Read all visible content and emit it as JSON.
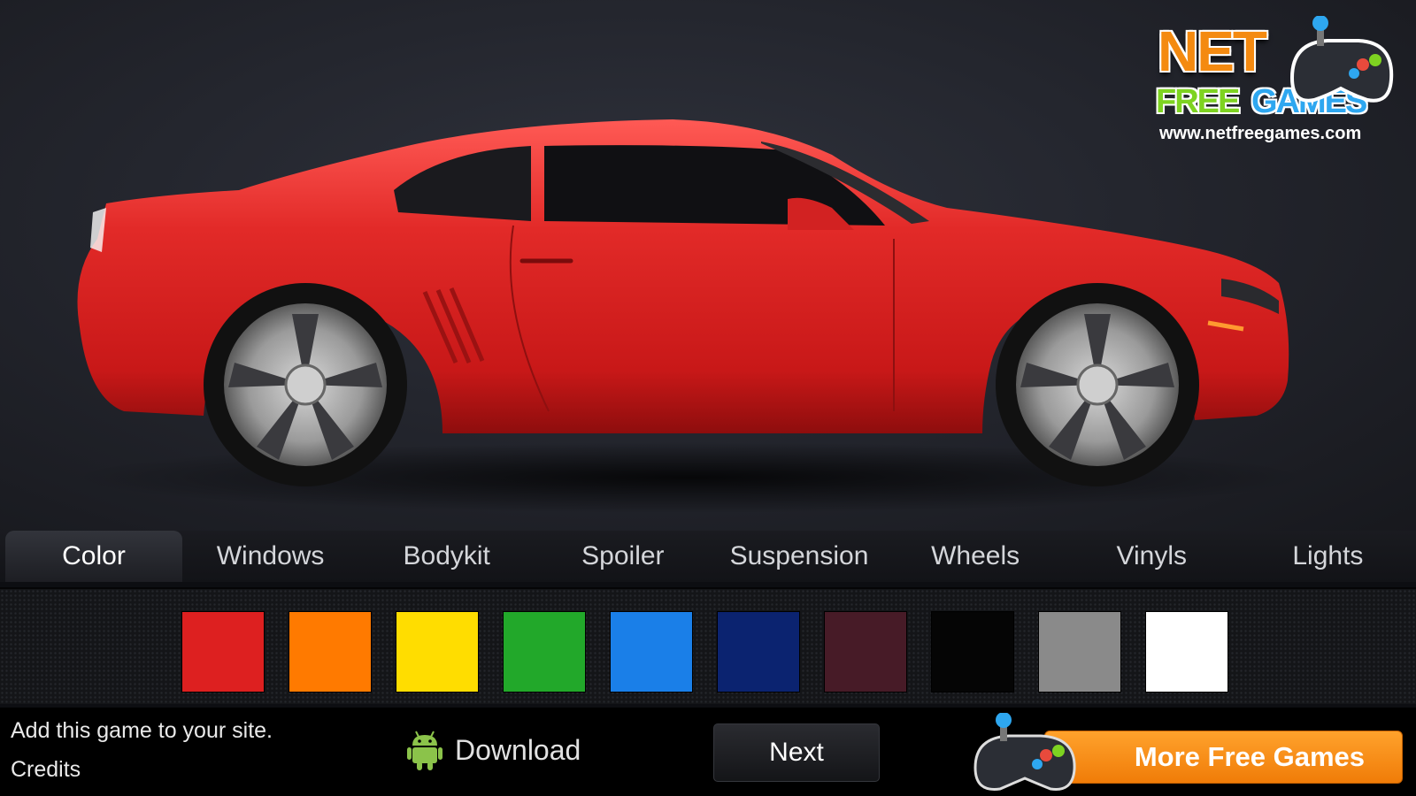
{
  "logo": {
    "line1": "NET",
    "line2a": "FREE",
    "line2b": "GAMES",
    "url": "www.netfreegames.com"
  },
  "car": {
    "body_color": "#e02a2a"
  },
  "tabs": [
    {
      "label": "Color",
      "active": true
    },
    {
      "label": "Windows"
    },
    {
      "label": "Bodykit"
    },
    {
      "label": "Spoiler"
    },
    {
      "label": "Suspension"
    },
    {
      "label": "Wheels"
    },
    {
      "label": "Vinyls"
    },
    {
      "label": "Lights"
    }
  ],
  "swatches": [
    "#dd2020",
    "#ff7a00",
    "#ffdd00",
    "#22a82a",
    "#1a7fe8",
    "#0b2370",
    "#471b27",
    "#050505",
    "#8a8a8a",
    "#ffffff"
  ],
  "footer": {
    "add_label": "Add this game to your site.",
    "credits_label": "Credits",
    "download_label": "Download",
    "next_label": "Next",
    "more_label": "More Free Games"
  }
}
